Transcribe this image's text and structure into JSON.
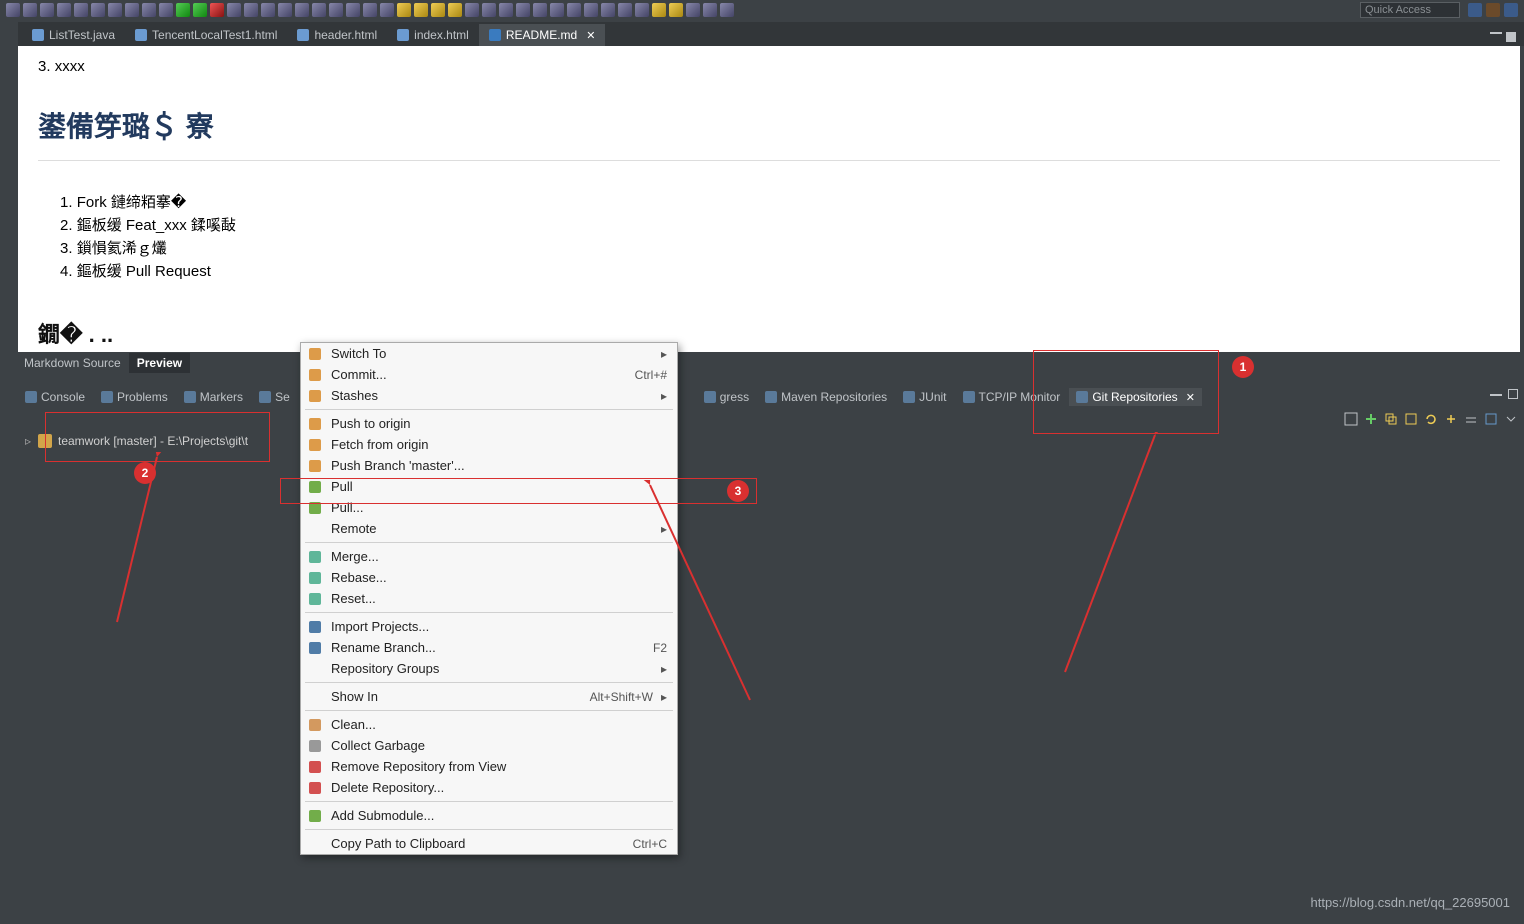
{
  "quick_access_placeholder": "Quick Access",
  "editor_tabs": [
    {
      "label": "ListTest.java",
      "active": false,
      "icon": "java"
    },
    {
      "label": "TencentLocalTest1.html",
      "active": false,
      "icon": "html"
    },
    {
      "label": "header.html",
      "active": false,
      "icon": "html"
    },
    {
      "label": "index.html",
      "active": false,
      "icon": "html"
    },
    {
      "label": "README.md",
      "active": true,
      "icon": "md",
      "closable": true
    }
  ],
  "editor_body": {
    "top_item_number": "3.",
    "top_item_text": "xxxx",
    "heading": "鍙備笌璐＄ 寮",
    "list": [
      {
        "n": "1.",
        "t": "Fork 鏈缔粨搴�"
      },
      {
        "n": "2.",
        "t": "鏂板缓 Feat_xxx 鍒嗘敮"
      },
      {
        "n": "3.",
        "t": "鎻愪氦浠ｇ爜"
      },
      {
        "n": "4.",
        "t": "鏂板缓 Pull Request"
      }
    ],
    "cutoff": "鐗� . .."
  },
  "md_subtabs": [
    {
      "label": "Markdown Source",
      "active": false
    },
    {
      "label": "Preview",
      "active": true
    }
  ],
  "panel_tabs": [
    {
      "label": "Console"
    },
    {
      "label": "Problems"
    },
    {
      "label": "Markers"
    },
    {
      "label": "Se"
    },
    {
      "label": "gress"
    },
    {
      "label": "Maven Repositories"
    },
    {
      "label": "JUnit"
    },
    {
      "label": "TCP/IP Monitor"
    },
    {
      "label": "Git Repositories",
      "active": true,
      "closable": true
    }
  ],
  "repo_tree_item": "teamwork [master] - E:\\Projects\\git\\t",
  "context_menu": [
    {
      "type": "item",
      "label": "Switch To",
      "submenu": true,
      "icon": "switch"
    },
    {
      "type": "item",
      "label": "Commit...",
      "accel": "Ctrl+#",
      "icon": "commit"
    },
    {
      "type": "item",
      "label": "Stashes",
      "submenu": true,
      "icon": "stash"
    },
    {
      "type": "sep"
    },
    {
      "type": "item",
      "label": "Push to origin",
      "icon": "push"
    },
    {
      "type": "item",
      "label": "Fetch from origin",
      "icon": "fetch"
    },
    {
      "type": "item",
      "label": "Push Branch 'master'...",
      "icon": "push"
    },
    {
      "type": "item",
      "label": "Pull",
      "icon": "pull"
    },
    {
      "type": "item",
      "label": "Pull...",
      "icon": "pull"
    },
    {
      "type": "item",
      "label": "Remote",
      "submenu": true
    },
    {
      "type": "sep"
    },
    {
      "type": "item",
      "label": "Merge...",
      "icon": "merge"
    },
    {
      "type": "item",
      "label": "Rebase...",
      "icon": "rebase"
    },
    {
      "type": "item",
      "label": "Reset...",
      "icon": "reset"
    },
    {
      "type": "sep"
    },
    {
      "type": "item",
      "label": "Import Projects...",
      "icon": "import"
    },
    {
      "type": "item",
      "label": "Rename Branch...",
      "accel": "F2",
      "icon": "rename"
    },
    {
      "type": "item",
      "label": "Repository Groups",
      "submenu": true
    },
    {
      "type": "sep"
    },
    {
      "type": "item",
      "label": "Show In",
      "accel": "Alt+Shift+W",
      "submenu": true
    },
    {
      "type": "sep"
    },
    {
      "type": "item",
      "label": "Clean...",
      "icon": "clean"
    },
    {
      "type": "item",
      "label": "Collect Garbage",
      "icon": "trash"
    },
    {
      "type": "item",
      "label": "Remove Repository from View",
      "icon": "remove"
    },
    {
      "type": "item",
      "label": "Delete Repository...",
      "icon": "delete"
    },
    {
      "type": "sep"
    },
    {
      "type": "item",
      "label": "Add Submodule...",
      "icon": "add"
    },
    {
      "type": "sep"
    },
    {
      "type": "item",
      "label": "Copy Path to Clipboard",
      "accel": "Ctrl+C"
    }
  ],
  "annotations": {
    "n1": "1",
    "n2": "2",
    "n3": "3"
  },
  "watermark": "https://blog.csdn.net/qq_22695001"
}
